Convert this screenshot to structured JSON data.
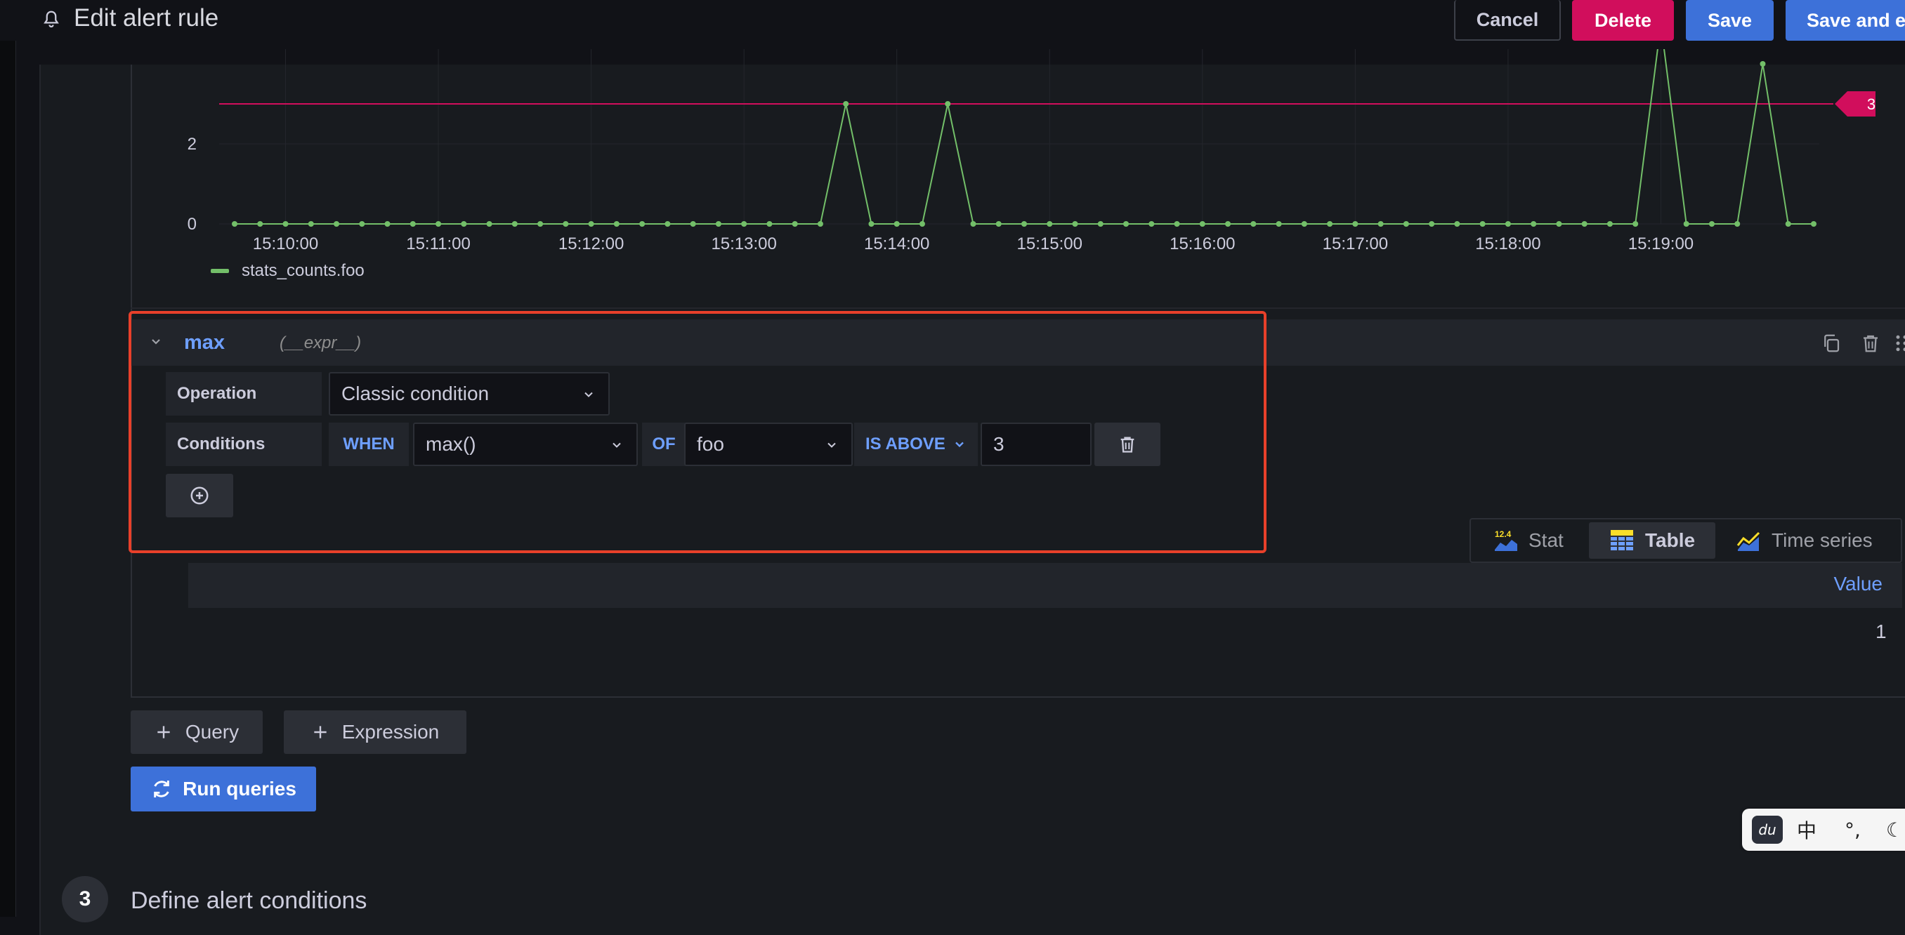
{
  "header": {
    "title": "Edit alert rule",
    "cancel_label": "Cancel",
    "delete_label": "Delete",
    "save_label": "Save",
    "save_exit_label": "Save and e"
  },
  "chart_data": {
    "type": "line",
    "y_ticks": [
      "0",
      "2"
    ],
    "ylim": [
      0,
      4
    ],
    "x_ticks": [
      "15:10:00",
      "15:11:00",
      "15:12:00",
      "15:13:00",
      "15:14:00",
      "15:15:00",
      "15:16:00",
      "15:17:00",
      "15:18:00",
      "15:19:00"
    ],
    "threshold": 3,
    "threshold_label": "3",
    "threshold_color": "#d10e5c",
    "series": [
      {
        "name": "stats_counts.foo",
        "color": "#73bf69",
        "values": [
          0,
          0,
          0,
          0,
          0,
          0,
          0,
          0,
          0,
          0,
          0,
          0,
          0,
          0,
          0,
          0,
          0,
          0,
          0,
          0,
          0,
          0,
          0,
          0,
          3,
          0,
          0,
          0,
          3,
          0,
          0,
          0,
          0,
          0,
          0,
          0,
          0,
          0,
          0,
          0,
          0,
          0,
          0,
          0,
          0,
          0,
          0,
          0,
          0,
          0,
          0,
          0,
          0,
          0,
          0,
          0,
          5,
          0,
          0,
          0,
          4,
          0,
          0
        ]
      }
    ]
  },
  "expression": {
    "name": "max",
    "type": "(__expr__)",
    "operation_label": "Operation",
    "operation_value": "Classic condition",
    "conditions_label": "Conditions",
    "when_label": "WHEN",
    "reducer_value": "max()",
    "of_label": "OF",
    "query_value": "foo",
    "evaluator_label": "IS ABOVE",
    "threshold_value": "3"
  },
  "viz_tabs": [
    {
      "label": "Stat",
      "badge": "12.4"
    },
    {
      "label": "Table"
    },
    {
      "label": "Time series"
    }
  ],
  "table": {
    "header": "Value",
    "value": "1"
  },
  "actions": {
    "query_label": "Query",
    "expression_label": "Expression",
    "run_label": "Run queries"
  },
  "step": {
    "number": "3",
    "title": "Define alert conditions"
  },
  "ime": {
    "logo": "du",
    "mode": "中",
    "punct": "°,",
    "moon": "☾"
  }
}
